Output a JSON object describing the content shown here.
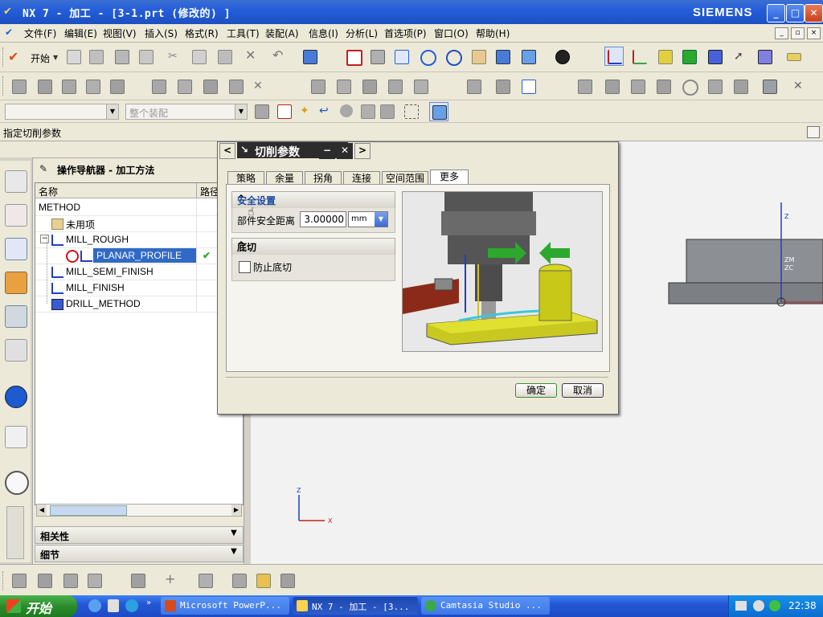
{
  "window": {
    "title": "NX 7 - 加工 - [3-1.prt  (修改的) ]",
    "brand": "SIEMENS",
    "controls": [
      "_",
      "□",
      "✕"
    ]
  },
  "menubar": {
    "items": [
      "文件(F)",
      "编辑(E)",
      "视图(V)",
      "插入(S)",
      "格式(R)",
      "工具(T)",
      "装配(A)",
      "信息(I)",
      "分析(L)",
      "首选项(P)",
      "窗口(O)",
      "帮助(H)"
    ]
  },
  "toolbar": {
    "start_label": "开始",
    "filter_placeholder": "",
    "assembly_filter": "整个装配"
  },
  "prompt": {
    "text": "指定切削参数"
  },
  "navigator": {
    "title": "操作导航器 - 加工方法",
    "columns": [
      "名称",
      "路径"
    ],
    "rows": [
      {
        "label": "METHOD",
        "icon": "none"
      },
      {
        "label": "未用项",
        "icon": "folder-icon"
      },
      {
        "label": "MILL_ROUGH",
        "icon": "method-icon"
      },
      {
        "label": "PLANAR_PROFILE",
        "icon": "operation-icon",
        "status": "✔",
        "selected": true
      },
      {
        "label": "MILL_SEMI_FINISH",
        "icon": "method-icon"
      },
      {
        "label": "MILL_FINISH",
        "icon": "method-icon"
      },
      {
        "label": "DRILL_METHOD",
        "icon": "drill-method-icon"
      }
    ],
    "sections": [
      "相关性",
      "细节"
    ]
  },
  "dialog": {
    "title": "切削参数",
    "tabs": [
      "策略",
      "余量",
      "拐角",
      "连接",
      "空间范围",
      "更多"
    ],
    "active_tab": "更多",
    "group_safety": {
      "title": "安全设置",
      "field_label": "部件安全距离",
      "value": "3.00000",
      "unit": "mm"
    },
    "group_undercut": {
      "title": "底切",
      "checkbox_label": "防止底切",
      "checked": false
    },
    "ok_label": "确定",
    "cancel_label": "取消"
  },
  "graphics": {
    "axis_labels": {
      "z": "Z",
      "x": "X",
      "zm": "ZM",
      "zc": "ZC",
      "yc": "C",
      "zr": "Z"
    }
  },
  "taskbar": {
    "start": "开始",
    "tasks": [
      {
        "label": "Microsoft PowerP...",
        "color": "#d84a1c"
      },
      {
        "label": "NX 7 - 加工 - [3...",
        "color": "#ffd24a",
        "active": true
      },
      {
        "label": "Camtasia Studio ...",
        "color": "#3ca84a"
      }
    ],
    "clock": "22:38"
  },
  "colors": {
    "accent": "#316ac5",
    "title_bar": "#245edb",
    "dialog_caption": "#2c2c2c",
    "ok_border": "#3a8a3a",
    "fixture_yellow": "#d8d820",
    "arrow_green": "#2ca82c"
  }
}
